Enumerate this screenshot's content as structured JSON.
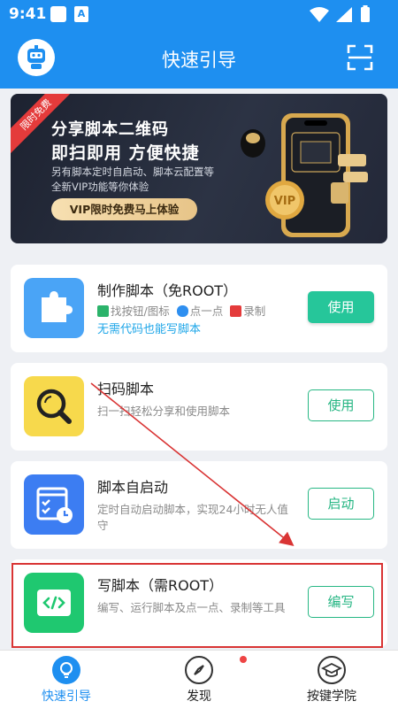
{
  "status_bar": {
    "time": "9:41",
    "notif_icon_text": "A"
  },
  "app_bar": {
    "title": "快速引导"
  },
  "banner": {
    "ribbon": "限时免费",
    "headline1": "分享脚本二维码",
    "headline2": "即扫即用 方便快捷",
    "sub1": "另有脚本定时自启动、脚本云配置等",
    "sub2": "全新VIP功能等你体验",
    "cta": "VIP限时免费马上体验",
    "coin_text": "VIP"
  },
  "cards": [
    {
      "title": "制作脚本（免ROOT）",
      "features": [
        "找按钮/图标",
        "点一点",
        "录制"
      ],
      "tagline": "无需代码也能写脚本",
      "button": "使用"
    },
    {
      "title": "扫码脚本",
      "desc": "扫一扫轻松分享和使用脚本",
      "button": "使用"
    },
    {
      "title": "脚本自启动",
      "desc": "定时自动启动脚本，实现24小时无人值守",
      "button": "启动"
    },
    {
      "title": "写脚本（需ROOT）",
      "desc": "编写、运行脚本及点一点、录制等工具",
      "button": "编写"
    }
  ],
  "tabs": [
    {
      "label": "快速引导"
    },
    {
      "label": "发现"
    },
    {
      "label": "按键学院"
    }
  ],
  "colors": {
    "primary": "#1e8ff0",
    "accent_green": "#26c69a",
    "annotation_red": "#d93434"
  }
}
